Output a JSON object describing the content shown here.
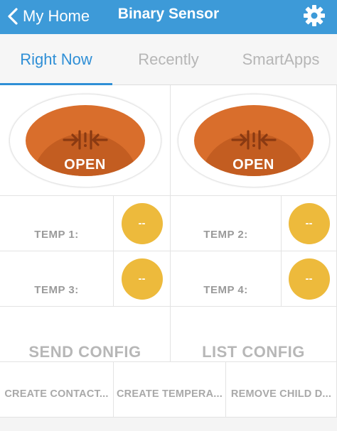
{
  "header": {
    "back_label": "My Home",
    "title": "Binary Sensor",
    "background_color": "#3d9ad8"
  },
  "tabs": [
    {
      "label": "Right Now",
      "active": true
    },
    {
      "label": "Recently",
      "active": false
    },
    {
      "label": "SmartApps",
      "active": false
    }
  ],
  "contacts": [
    {
      "state": "OPEN",
      "icon": "contact-open-icon",
      "color": "#d96e2c"
    },
    {
      "state": "OPEN",
      "icon": "contact-open-icon",
      "color": "#d96e2c"
    }
  ],
  "temps": [
    {
      "label": "TEMP 1:",
      "value": "--"
    },
    {
      "label": "TEMP 2:",
      "value": "--"
    },
    {
      "label": "TEMP 3:",
      "value": "--"
    },
    {
      "label": "TEMP 4:",
      "value": "--"
    }
  ],
  "temp_color": "#edba3c",
  "buttons": {
    "send_config": "SEND CONFIG",
    "list_config": "LIST CONFIG",
    "create_contact": "CREATE CONTACT...",
    "create_temperature": "CREATE TEMPERA...",
    "remove_child": "REMOVE CHILD D..."
  }
}
